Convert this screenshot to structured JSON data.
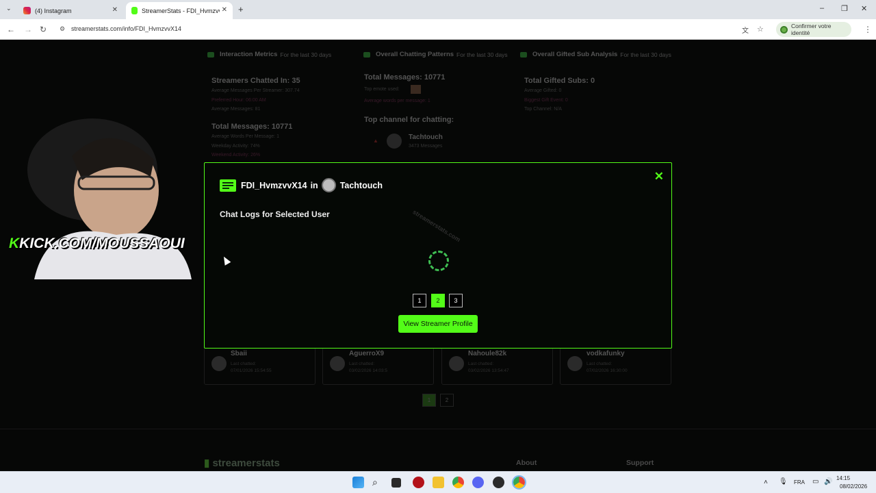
{
  "browser": {
    "tabs": [
      {
        "title": "(4) Instagram",
        "active": false
      },
      {
        "title": "StreamerStats - FDI_HvmzvvX14",
        "active": true
      }
    ],
    "url": "streamerstats.com/info/FDI_HvmzvvX14",
    "identity_button": "Confirmer votre identité"
  },
  "background": {
    "sections": [
      {
        "title": "Interaction Metrics",
        "subtitle": "For the last 30 days"
      },
      {
        "title": "Overall Chatting Patterns",
        "subtitle": "For the last 30 days"
      },
      {
        "title": "Overall Gifted Sub Analysis",
        "subtitle": "For the last 30 days"
      }
    ],
    "streamers_chatted": "Streamers Chatted In: 35",
    "avg_msg_per_streamer": "Average Messages Per Streamer: 307.74",
    "preferred_hour": "Preferred Hour: 06:00 AM",
    "avg_messages": "Average Messages: 81",
    "total_messages_left": "Total Messages: 10771",
    "avg_words": "Average Words Per Message: 1",
    "weekday_activity": "Weekday Activity: 74%",
    "weekend_activity": "Weekend Activity: 26%",
    "total_messages_mid": "Total Messages: 10771",
    "top_emote": "Top emote used:",
    "avg_words_mid": "Average words per message: 1",
    "top_channel_label": "Top channel for chatting:",
    "top_channel_name": "Tachtouch",
    "top_channel_msgs": "3473 Messages",
    "total_gifted": "Total Gifted Subs: 0",
    "avg_gifted": "Average Gifted: 0",
    "biggest_gift": "Biggest Gift Event: 0",
    "top_channel_gift": "Top Channel: N/A",
    "cards": [
      {
        "name": "Sbaii",
        "sub": "Last chatted:",
        "date": "07/01/2026 15:54:55"
      },
      {
        "name": "AguerroX9",
        "sub": "Last chatted:",
        "date": "03/02/2026 14:03:5"
      },
      {
        "name": "Nahoule82k",
        "sub": "Last chatted:",
        "date": "03/02/2026 13:54:47"
      },
      {
        "name": "vodkafunky",
        "sub": "Last chatted:",
        "date": "07/02/2026 16:30:00"
      }
    ],
    "pages": [
      "1",
      "2"
    ],
    "footer_logo": "streamerstats",
    "footer_about": "About",
    "footer_support": "Support"
  },
  "overlay": {
    "kick_text": "KICK.COM/MOUSSAOUI"
  },
  "modal": {
    "user": "FDI_HvmzvvX14",
    "in_text": "in",
    "channel": "Tachtouch",
    "close": "✕",
    "heading": "Chat Logs for Selected User",
    "watermark": "streamerstats.com",
    "pages": [
      "1",
      "2",
      "3"
    ],
    "active_page": "2",
    "profile_button": "View Streamer Profile"
  },
  "taskbar": {
    "lang": "FRA",
    "time": "14:15",
    "date": "08/02/2026"
  }
}
